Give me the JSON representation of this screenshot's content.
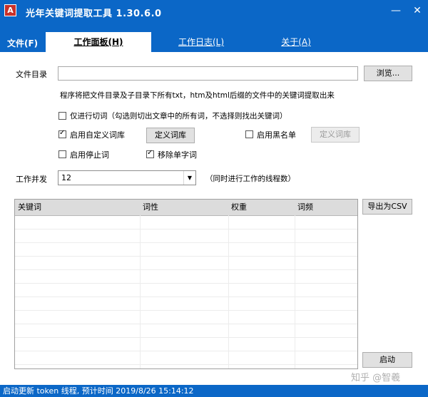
{
  "window": {
    "title": "光年关键词提取工具 1.30.6.0",
    "icon_label": "A",
    "minimize": "—",
    "close": "✕"
  },
  "menu": {
    "file": "文件(F)",
    "tabs": [
      {
        "label": "工作面板(H)",
        "active": true
      },
      {
        "label": "工作日志(L)",
        "active": false
      },
      {
        "label": "关于(A)",
        "active": false
      }
    ]
  },
  "form": {
    "dir_label": "文件目录",
    "dir_value": "",
    "browse_label": "浏览...",
    "hint": "程序将把文件目录及子目录下所有txt，htm及html后缀的文件中的关键词提取出来",
    "cut_only": {
      "label": "仅进行切词（勾选则切出文章中的所有词，不选择则找出关键词）",
      "checked": false
    },
    "custom_dict": {
      "label": "启用自定义词库",
      "checked": true
    },
    "define_dict_label": "定义词库",
    "blacklist": {
      "label": "启用黑名单",
      "checked": false
    },
    "define_blacklist_label": "定义词库",
    "stopwords": {
      "label": "启用停止词",
      "checked": false
    },
    "remove_single": {
      "label": "移除单字词",
      "checked": true
    },
    "concurrency_label": "工作并发",
    "concurrency_value": "12",
    "concurrency_hint": "（同时进行工作的线程数）"
  },
  "table": {
    "columns": [
      "关键词",
      "词性",
      "权重",
      "词频"
    ],
    "rows": []
  },
  "actions": {
    "export_label": "导出为CSV",
    "start_label": "启动"
  },
  "status": {
    "text": "启动更新 token 线程, 预计时间 2019/8/26 15:14:12"
  },
  "watermark": "知乎 @智羲",
  "colors": {
    "accent": "#0b67c7"
  }
}
